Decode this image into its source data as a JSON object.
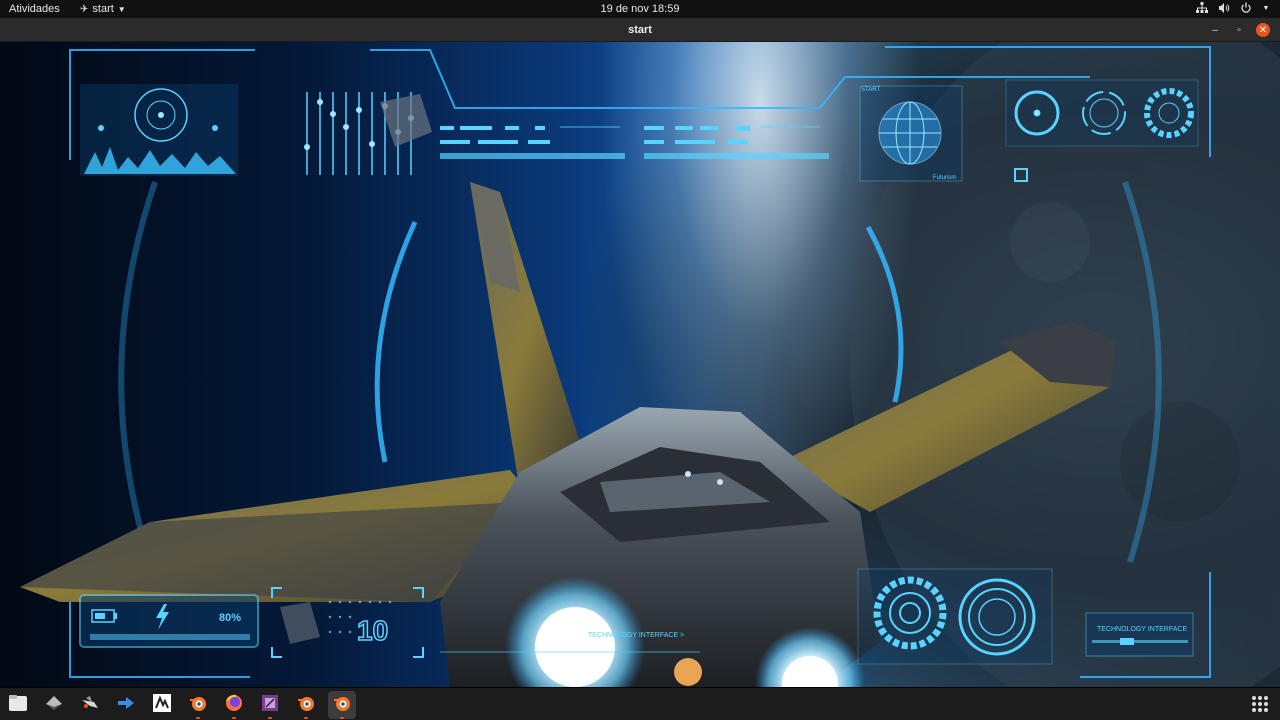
{
  "topbar": {
    "activities": "Atividades",
    "app_name": "start",
    "clock": "19 de nov  18:59",
    "tray_icons": [
      "network-icon",
      "volume-icon",
      "power-icon"
    ]
  },
  "window": {
    "title": "start",
    "controls": [
      "minimize",
      "maximize",
      "close"
    ]
  },
  "hud": {
    "battery_percent": "80%",
    "counter": "10",
    "globe_label": "Futurism",
    "start_label": "START",
    "tech_label_center": "TECHNOLOGY INTERFACE >",
    "tech_label_right": "TECHNOLOGY INTERFACE"
  },
  "taskbar": {
    "apps": [
      {
        "name": "files",
        "icon": "files-icon",
        "active": false
      },
      {
        "name": "app-2",
        "icon": "diamond-app-icon",
        "active": false
      },
      {
        "name": "app-3",
        "icon": "spaceship-app-icon",
        "active": false
      },
      {
        "name": "app-4",
        "icon": "arrow-app-icon",
        "active": false
      },
      {
        "name": "app-5",
        "icon": "inkscape-like-icon",
        "active": false
      },
      {
        "name": "blender",
        "icon": "blender-icon",
        "active": false,
        "running": true
      },
      {
        "name": "firefox",
        "icon": "firefox-icon",
        "active": false,
        "running": true
      },
      {
        "name": "app-8",
        "icon": "purple-app-icon",
        "active": false,
        "running": true
      },
      {
        "name": "blender-2",
        "icon": "blender-icon",
        "active": false,
        "running": true
      },
      {
        "name": "blender-3",
        "icon": "blender-icon",
        "active": true,
        "running": true
      }
    ],
    "show_apps": "show-applications-icon"
  },
  "colors": {
    "hud": "#59d3ff",
    "accent": "#e95420",
    "topbar": "#111111",
    "titlebar": "#2b2b2b"
  }
}
